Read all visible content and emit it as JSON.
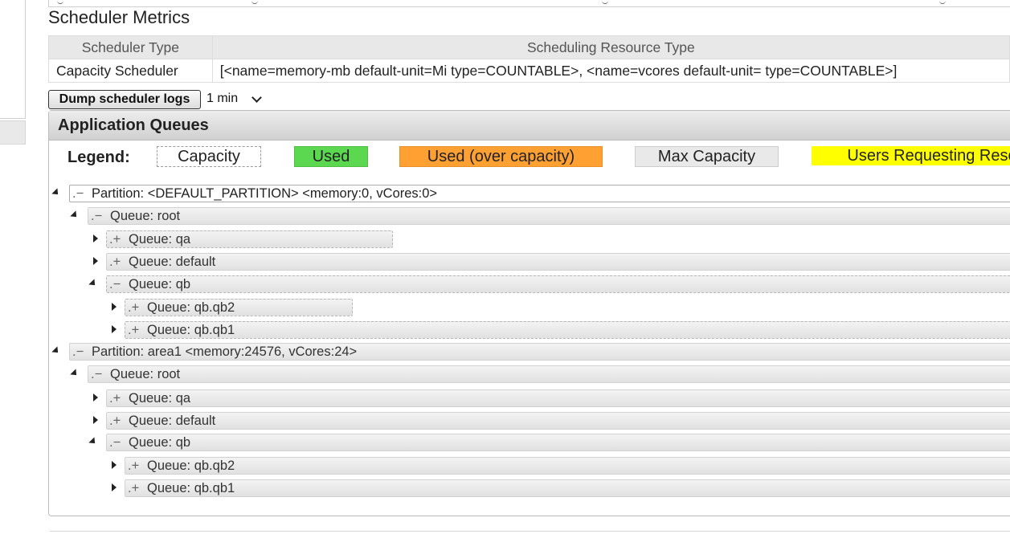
{
  "metrics": {
    "title": "Scheduler Metrics",
    "headers": [
      "Scheduler Type",
      "Scheduling Resource Type"
    ],
    "row": [
      "Capacity Scheduler",
      "[<name=memory-mb default-unit=Mi type=COUNTABLE>, <name=vcores default-unit= type=COUNTABLE>]"
    ]
  },
  "dump": {
    "button_label": "Dump scheduler logs",
    "interval_value": "1 min"
  },
  "queues": {
    "title": "Application Queues",
    "legend": {
      "label": "Legend:",
      "capacity": "Capacity",
      "used": "Used",
      "over": "Used (over capacity)",
      "max": "Max Capacity",
      "users": "Users Requesting Reso"
    },
    "tree": [
      {
        "sign": ".−",
        "label": "Partition: <DEFAULT_PARTITION> <memory:0, vCores:0>"
      },
      {
        "sign": ".−",
        "label": "Queue: root"
      },
      {
        "sign": ".+",
        "label": "Queue: qa"
      },
      {
        "sign": ".+",
        "label": "Queue: default"
      },
      {
        "sign": ".−",
        "label": "Queue: qb"
      },
      {
        "sign": ".+",
        "label": "Queue: qb.qb2"
      },
      {
        "sign": ".+",
        "label": "Queue: qb.qb1"
      },
      {
        "sign": ".−",
        "label": "Partition: area1 <memory:24576, vCores:24>"
      },
      {
        "sign": ".−",
        "label": "Queue: root"
      },
      {
        "sign": ".+",
        "label": "Queue: qa"
      },
      {
        "sign": ".+",
        "label": "Queue: default"
      },
      {
        "sign": ".−",
        "label": "Queue: qb"
      },
      {
        "sign": ".+",
        "label": "Queue: qb.qb2"
      },
      {
        "sign": ".+",
        "label": "Queue: qb.qb1"
      }
    ]
  },
  "colors": {
    "used": "#5bd84f",
    "over_capacity": "#ffa032",
    "max_capacity": "#e9e9e9",
    "users_requesting": "#ffff00"
  }
}
